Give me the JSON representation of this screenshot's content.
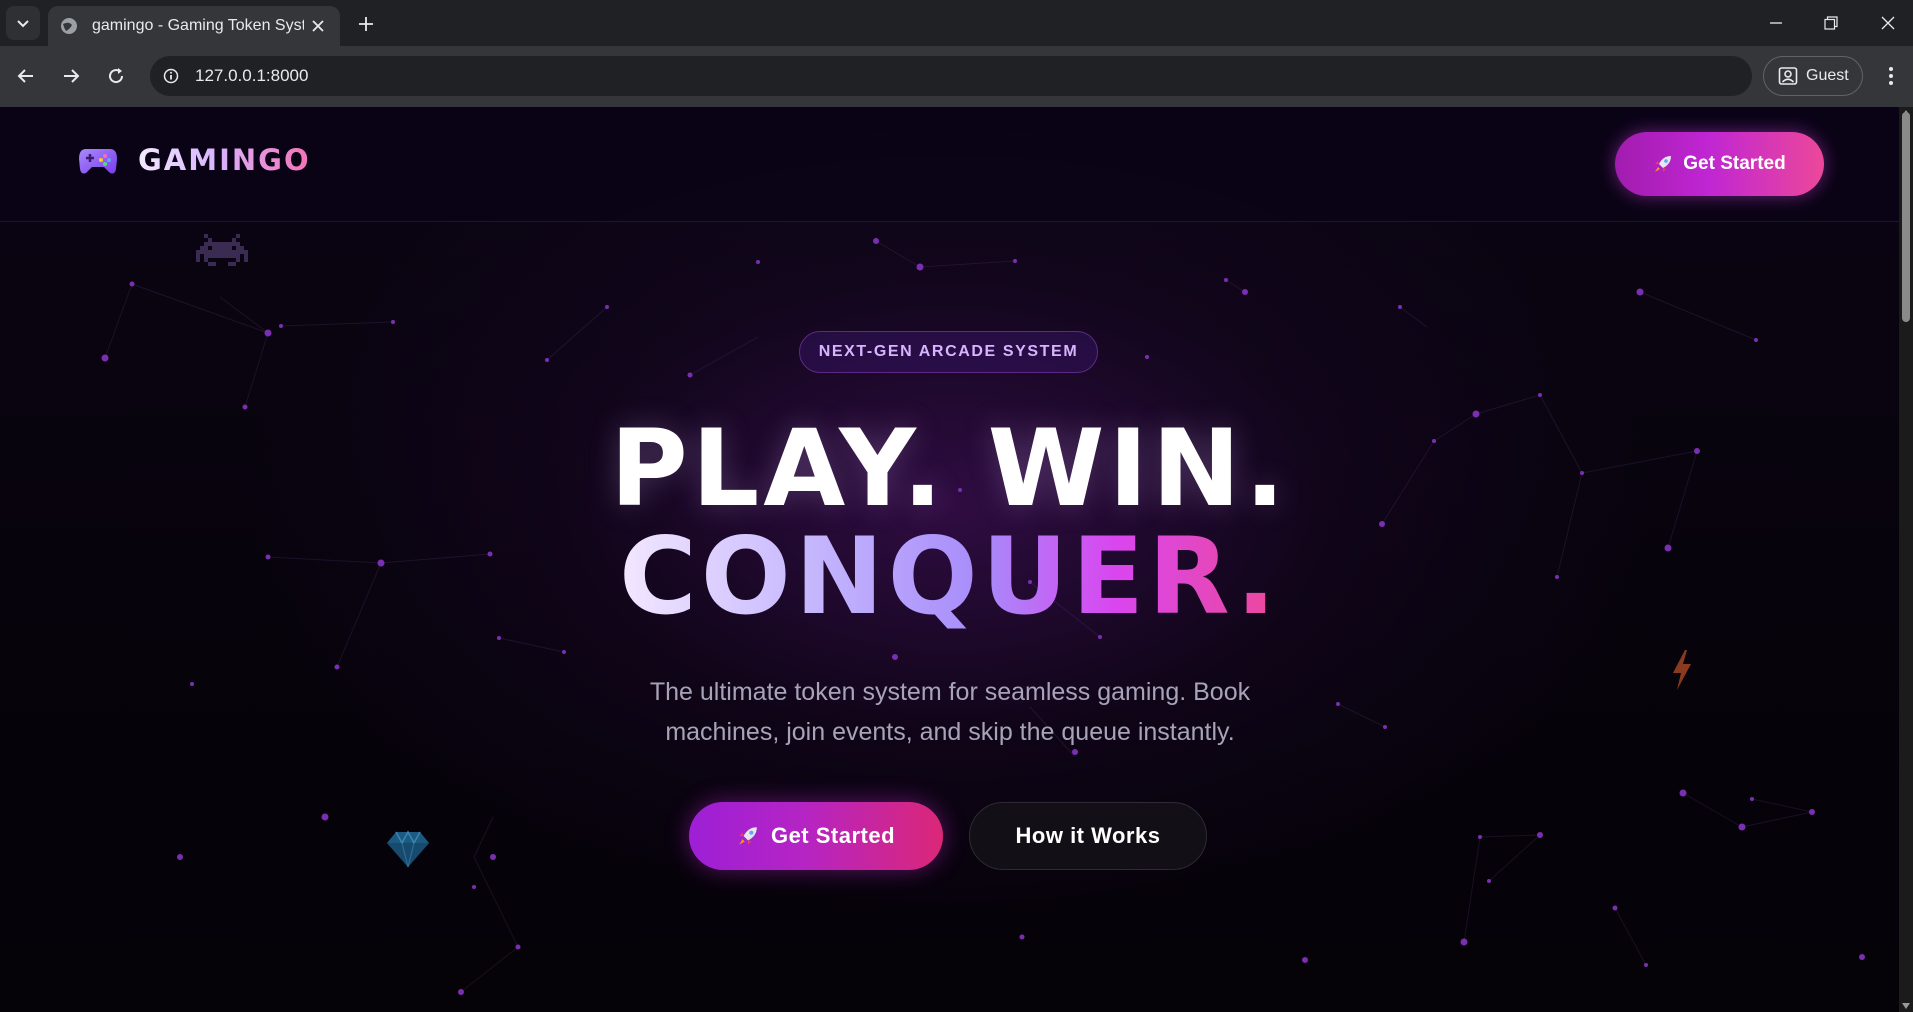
{
  "browser": {
    "tab_title": "gamingo - Gaming Token System",
    "url": "127.0.0.1:8000",
    "profile_label": "Guest"
  },
  "header": {
    "logo_text": "GAMINGO",
    "cta_label": "Get Started"
  },
  "hero": {
    "badge": "NEXT-GEN ARCADE SYSTEM",
    "headline_line1": "PLAY. WIN.",
    "headline_line2": "CONQUER.",
    "subtitle": "The ultimate token system for seamless gaming. Book machines, join events, and skip the queue instantly.",
    "primary_cta": "Get Started",
    "secondary_cta": "How it Works"
  },
  "colors": {
    "accent_purple": "#a21caf",
    "accent_pink": "#ec4899",
    "badge_text": "#d8b4fe",
    "background": "#050208"
  },
  "icons": {
    "logo": "gamepad-icon",
    "cta": "rocket-icon",
    "floaters": [
      "space-invader-icon",
      "lightning-icon",
      "gem-icon"
    ]
  }
}
